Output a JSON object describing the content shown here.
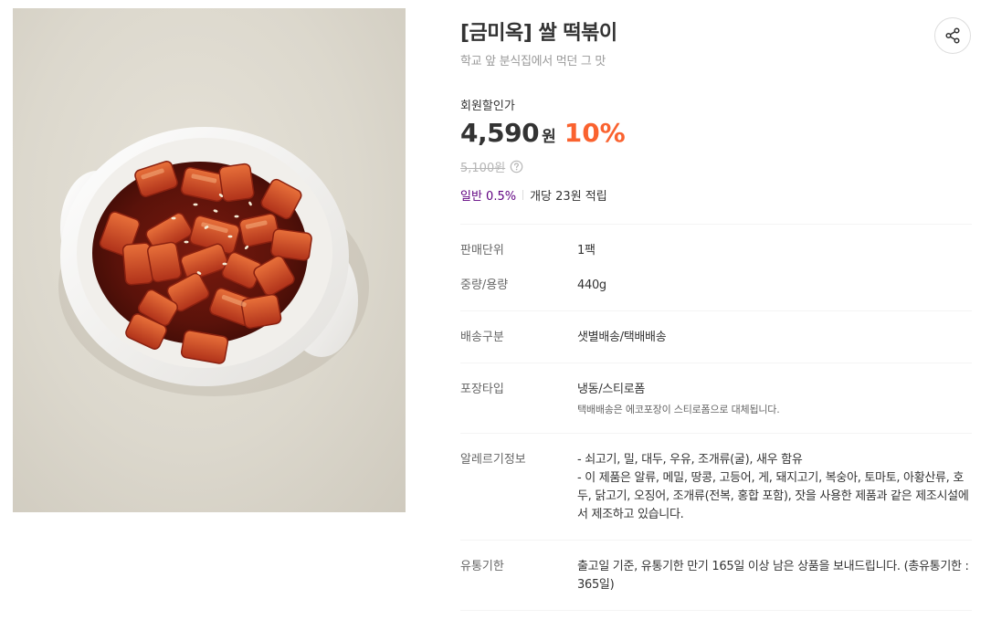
{
  "product": {
    "image_alt": "쌀 떡볶이",
    "title": "[금미옥] 쌀 떡볶이",
    "subtitle": "학교 앞 분식집에서 먹던 그 맛",
    "share_icon": "share-icon"
  },
  "price": {
    "member_label": "회원할인가",
    "value": "4,590",
    "unit": "원",
    "discount": "10%",
    "original": "5,100원",
    "help_icon": "question-circle-icon"
  },
  "points": {
    "grade": "일반 0.5%",
    "text": "개당 23원 적립"
  },
  "details": {
    "sales_unit": {
      "label": "판매단위",
      "value": "1팩"
    },
    "weight": {
      "label": "중량/용량",
      "value": "440g"
    },
    "delivery": {
      "label": "배송구분",
      "value": "샛별배송/택배배송"
    },
    "packaging": {
      "label": "포장타입",
      "value": "냉동/스티로폼",
      "note": "택배배송은 에코포장이 스티로폼으로 대체됩니다."
    },
    "allergy": {
      "label": "알레르기정보",
      "lines": [
        "- 쇠고기, 밀, 대두, 우유, 조개류(굴), 새우 함유",
        "- 이 제품은 알류, 메밀, 땅콩, 고등어, 게, 돼지고기, 복숭아, 토마토, 아황산류, 호두, 닭고기, 오징어, 조개류(전복, 홍합 포함), 잣을 사용한 제품과 같은 제조시설에서 제조하고 있습니다."
      ]
    },
    "shelf_life": {
      "label": "유통기한",
      "value": "출고일 기준, 유통기한 만기 165일 이상 남은 상품을 보내드립니다. (총유통기한 : 365일)"
    }
  },
  "colors": {
    "discount": "#fa622f",
    "grade": "#5f0080",
    "label": "#666666",
    "muted": "#999999"
  }
}
